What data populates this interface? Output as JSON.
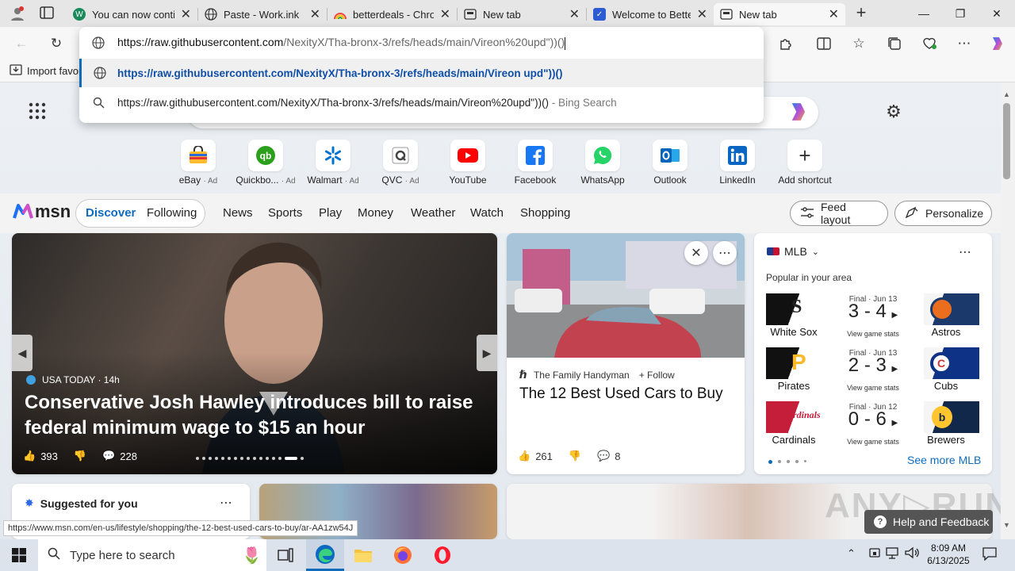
{
  "tabs": [
    {
      "title": "You can now contin",
      "icon": "w-logo-icon",
      "color": "#1b8a5a"
    },
    {
      "title": "Paste - Work.ink",
      "icon": "globe-icon",
      "color": "#555555"
    },
    {
      "title": "betterdeals - Chron",
      "icon": "rainbow-icon",
      "color": "#e66"
    },
    {
      "title": "New tab",
      "icon": "newtab-icon",
      "color": "#333"
    },
    {
      "title": "Welcome to Better",
      "icon": "betterdeals-icon",
      "color": "#2d5bd3"
    },
    {
      "title": "New tab",
      "icon": "newtab-icon",
      "color": "#333"
    }
  ],
  "address": {
    "host": "https://raw.githubusercontent.com",
    "path": "/NexityX/Tha-bronx-3/refs/heads/main/Vireon%20upd\"))()",
    "suggest1": "https://raw.githubusercontent.com/NexityX/Tha-bronx-3/refs/heads/main/Vireon upd\"))()",
    "suggest2": "https://raw.githubusercontent.com/NexityX/Tha-bronx-3/refs/heads/main/Vireon%20upd\"))()",
    "suggest2_suffix": " - Bing Search"
  },
  "favbar": {
    "import": "Import favor"
  },
  "shortcuts": [
    {
      "label": "eBay",
      "ad": "· Ad"
    },
    {
      "label": "Quickbo...",
      "ad": "· Ad"
    },
    {
      "label": "Walmart",
      "ad": "· Ad"
    },
    {
      "label": "QVC",
      "ad": "· Ad"
    },
    {
      "label": "YouTube",
      "ad": ""
    },
    {
      "label": "Facebook",
      "ad": ""
    },
    {
      "label": "WhatsApp",
      "ad": ""
    },
    {
      "label": "Outlook",
      "ad": ""
    },
    {
      "label": "LinkedIn",
      "ad": ""
    },
    {
      "label": "Add shortcut",
      "ad": ""
    }
  ],
  "msn": {
    "logo": "msn",
    "nav": [
      "Discover",
      "Following",
      "News",
      "Sports",
      "Play",
      "Money",
      "Weather",
      "Watch",
      "Shopping"
    ],
    "feed_layout": "Feed layout",
    "personalize": "Personalize"
  },
  "hero": {
    "source": "USA TODAY · 14h",
    "title": "Conservative Josh Hawley introduces bill to raise federal minimum wage to $15 an hour",
    "likes": "393",
    "comments": "228"
  },
  "card2": {
    "source": "The Family Handyman",
    "follow": "Follow",
    "title": "The 12 Best Used Cars to Buy",
    "likes": "261",
    "comments": "8"
  },
  "mlb": {
    "title": "MLB",
    "subtitle": "Popular in your area",
    "games": [
      {
        "final": "Final · Jun 13",
        "score": "3 - 4",
        "home": "White Sox",
        "away": "Astros",
        "link": "View game stats"
      },
      {
        "final": "Final · Jun 13",
        "score": "2 - 3",
        "home": "Pirates",
        "away": "Cubs",
        "link": "View game stats"
      },
      {
        "final": "Final · Jun 12",
        "score": "0 - 6",
        "home": "Cardinals",
        "away": "Brewers",
        "link": "View game stats"
      }
    ],
    "see_more": "See more MLB"
  },
  "suggested": "Suggested for you",
  "help": "Help and Feedback",
  "status_url": "https://www.msn.com/en-us/lifestyle/shopping/the-12-best-used-cars-to-buy/ar-AA1zw54J",
  "taskbar": {
    "search": "Type here to search",
    "time": "8:09 AM",
    "date": "6/13/2025"
  }
}
